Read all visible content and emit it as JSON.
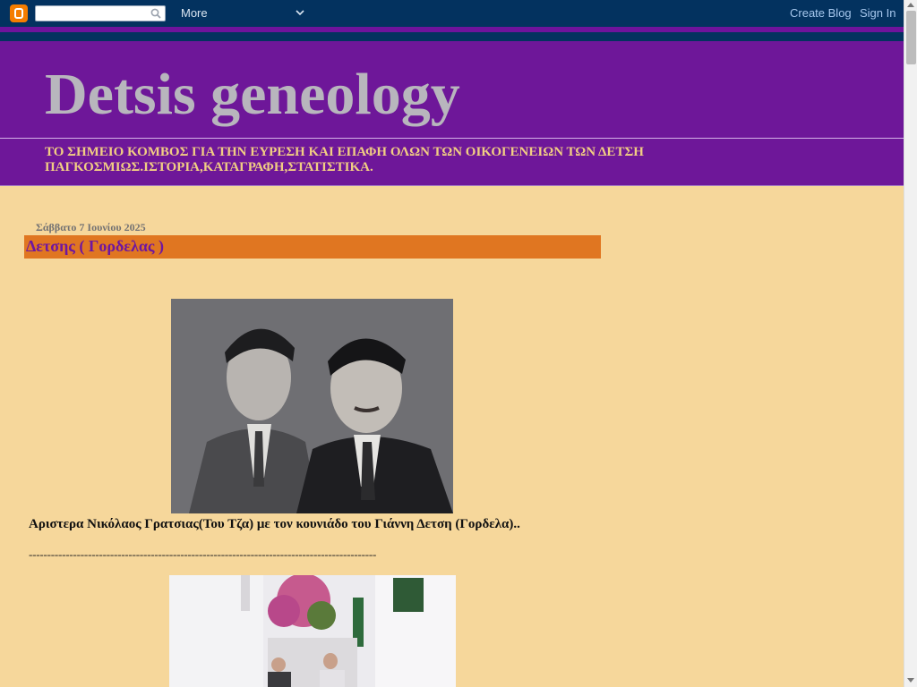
{
  "navbar": {
    "logo_icon": "blogger-logo-icon",
    "search_placeholder": "",
    "more_label": "More",
    "create_blog_label": "Create Blog",
    "sign_in_label": "Sign In"
  },
  "header": {
    "title": "Detsis geneology",
    "description": "ΤΟ ΣΗΜΕΙΟ ΚΟΜΒΟΣ ΓΙΑ ΤΗΝ ΕΥΡΕΣΗ ΚΑΙ ΕΠΑΦΗ ΟΛΩΝ ΤΩΝ ΟΙΚΟΓΕΝΕΙΩΝ ΤΩΝ ΔΕΤΣΗ ΠΑΓΚΟΣΜΙΩΣ.ΙΣΤΟΡΙΑ,ΚΑΤΑΓΡΑΦΗ,ΣΤΑΤΙΣΤΙΚΑ."
  },
  "post": {
    "date": "Σάββατο 7 Ιουνίου 2025",
    "title": "Δετσης ( Γορδελας )",
    "caption": "Αριστερα Νικόλαος Γρατσιας(Του Τζα)  με τον κουνιάδο του Γιάννη Δετση (Γορδελα)..",
    "divider": "----------------------------------------------------------------------------------------------"
  },
  "colors": {
    "navbar": "#03325f",
    "header": "#6e1799",
    "title_text": "#b8b6bd",
    "description_text": "#f1ce83",
    "page_background": "#f6d79b",
    "post_title_bar": "#e07621",
    "post_title_text": "#6f16a0"
  }
}
